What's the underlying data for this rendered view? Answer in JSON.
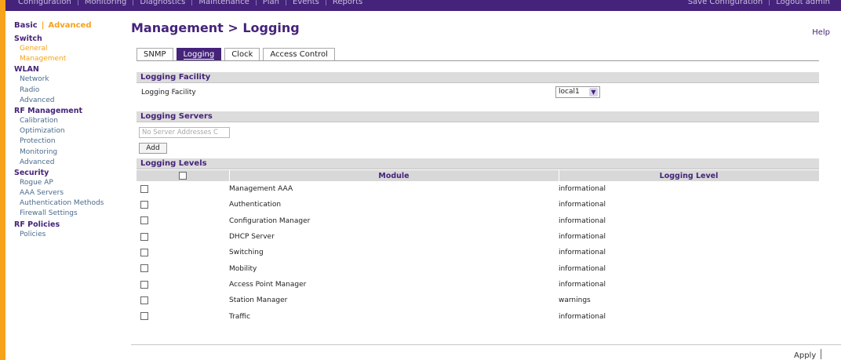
{
  "topnav": {
    "left_items": [
      "Configuration",
      "Monitoring",
      "Diagnostics",
      "Maintenance",
      "Plan",
      "Events",
      "Reports"
    ],
    "right_items": [
      "Save Configuration",
      "Logout admin"
    ]
  },
  "sidebar": {
    "mode_basic": "Basic",
    "mode_separator": "|",
    "mode_advanced": "Advanced",
    "sections": [
      {
        "title": "Switch",
        "items": [
          {
            "label": "General",
            "active": false,
            "highlight": true
          },
          {
            "label": "Management",
            "active": true,
            "highlight": true
          }
        ]
      },
      {
        "title": "WLAN",
        "items": [
          {
            "label": "Network"
          },
          {
            "label": "Radio"
          },
          {
            "label": "Advanced"
          }
        ]
      },
      {
        "title": "RF Management",
        "items": [
          {
            "label": "Calibration"
          },
          {
            "label": "Optimization"
          },
          {
            "label": "Protection"
          },
          {
            "label": "Monitoring"
          },
          {
            "label": "Advanced"
          }
        ]
      },
      {
        "title": "Security",
        "items": [
          {
            "label": "Rogue AP"
          },
          {
            "label": "AAA Servers"
          },
          {
            "label": "Authentication Methods"
          },
          {
            "label": "Firewall Settings"
          }
        ]
      },
      {
        "title": "RF Policies",
        "items": [
          {
            "label": "Policies"
          }
        ]
      }
    ]
  },
  "page": {
    "title": "Management > Logging",
    "help": "Help"
  },
  "tabs": [
    {
      "label": "SNMP",
      "active": false
    },
    {
      "label": "Logging",
      "active": true
    },
    {
      "label": "Clock",
      "active": false
    },
    {
      "label": "Access Control",
      "active": false
    }
  ],
  "logging_facility": {
    "header": "Logging Facility",
    "label": "Logging Facility",
    "value": "local1"
  },
  "logging_servers": {
    "header": "Logging Servers",
    "placeholder": "No Server Addresses C",
    "add_button": "Add"
  },
  "logging_levels": {
    "header": "Logging Levels",
    "col_module": "Module",
    "col_level": "Logging Level",
    "rows": [
      {
        "module": "Management AAA",
        "level": "informational"
      },
      {
        "module": "Authentication",
        "level": "informational"
      },
      {
        "module": "Configuration Manager",
        "level": "informational"
      },
      {
        "module": "DHCP Server",
        "level": "informational"
      },
      {
        "module": "Switching",
        "level": "informational"
      },
      {
        "module": "Mobility",
        "level": "informational"
      },
      {
        "module": "Access Point Manager",
        "level": "informational"
      },
      {
        "module": "Station Manager",
        "level": "warnings"
      },
      {
        "module": "Traffic",
        "level": "informational"
      }
    ]
  },
  "footer": {
    "apply": "Apply"
  },
  "colors": {
    "brand_purple": "#45237a",
    "accent_orange": "#f6a21a",
    "link_blue": "#4a6b8c"
  }
}
